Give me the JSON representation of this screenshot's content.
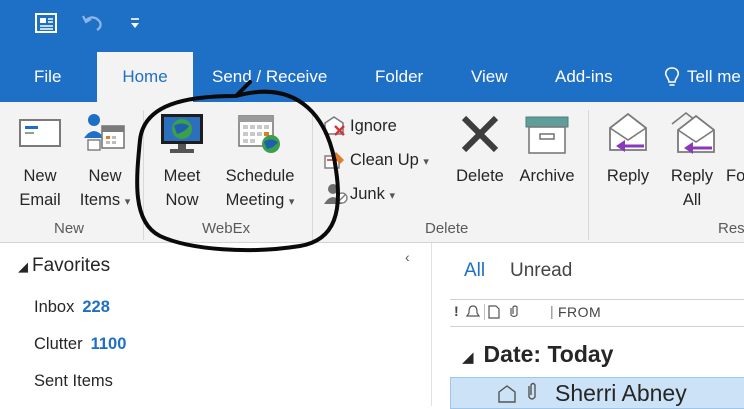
{
  "ribbon_tabs": [
    {
      "label": "File"
    },
    {
      "label": "Home"
    },
    {
      "label": "Send / Receive"
    },
    {
      "label": "Folder"
    },
    {
      "label": "View"
    },
    {
      "label": "Add-ins"
    },
    {
      "label": "Tell me"
    }
  ],
  "groups": {
    "new": {
      "label": "New",
      "new_email": [
        "New",
        "Email"
      ],
      "new_items": [
        "New",
        "Items"
      ]
    },
    "webex": {
      "label": "WebEx",
      "meet_now": [
        "Meet",
        "Now"
      ],
      "schedule_meeting": [
        "Schedule",
        "Meeting"
      ]
    },
    "delete": {
      "label": "Delete",
      "ignore": "Ignore",
      "clean_up": "Clean Up",
      "junk": "Junk",
      "delete": "Delete",
      "archive": "Archive"
    },
    "respond": {
      "label": "Res",
      "reply": "Reply",
      "reply_all": [
        "Reply",
        "All"
      ],
      "forward": "Fo"
    }
  },
  "folder_pane": {
    "favorites_label": "Favorites",
    "folders": [
      {
        "name": "Inbox",
        "count": "228"
      },
      {
        "name": "Clutter",
        "count": "1100"
      },
      {
        "name": "Sent Items",
        "count": ""
      }
    ]
  },
  "message_list": {
    "filters": {
      "all": "All",
      "unread": "Unread"
    },
    "column_from": "FROM",
    "date_group": "Date: Today",
    "selected_sender": "Sherri Abney"
  },
  "colors": {
    "brand_blue": "#1e6fc6",
    "ribbon_bg": "#f3f3f3",
    "selection": "#cce2f6"
  }
}
